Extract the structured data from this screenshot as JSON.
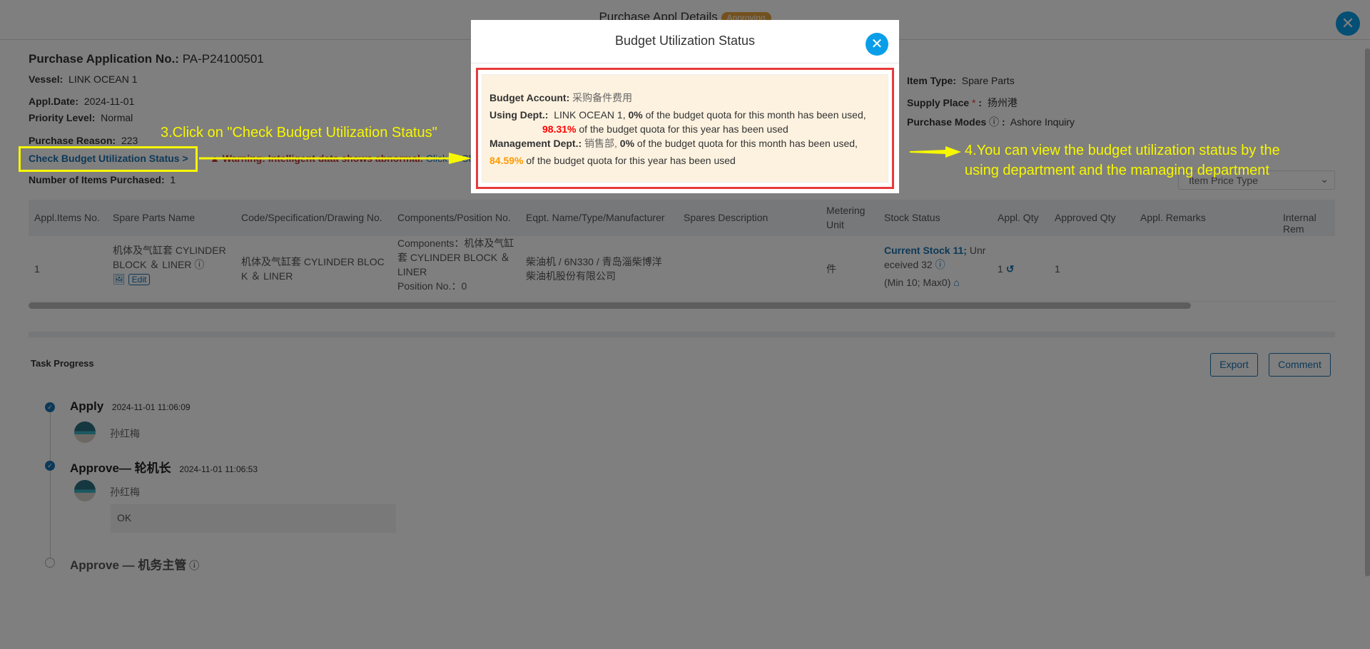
{
  "header": {
    "title": "Purchase Appl Details",
    "status": "Approving"
  },
  "info": {
    "app_no_label": "Purchase Application No.:",
    "app_no": "PA-P24100501",
    "vessel_label": "Vessel:",
    "vessel": "LINK OCEAN 1",
    "date_label": "Appl.Date:",
    "date": "2024-11-01",
    "priority_label": "Priority Level:",
    "priority": "Normal",
    "reason_label": "Purchase Reason:",
    "reason": "223",
    "check_budget_link": "Check Budget Utilization Status >",
    "warning": "Warning: Intelligent data shows abnormal.",
    "warning_link": "Click to Ch",
    "items_label": "Number of Items Purchased:",
    "items": "1",
    "item_type_label": "Item Type:",
    "item_type": "Spare Parts",
    "supply_label": "Supply Place",
    "supply": "扬州港",
    "modes_label": "Purchase Modes",
    "modes": "Ashore Inquiry",
    "price_type_placeholder": "Item Price Type"
  },
  "table": {
    "headers": [
      "Appl.Items No.",
      "Spare Parts Name",
      "Code/Specification/Drawing No.",
      "Components/Position No.",
      "Eqpt. Name/Type/Manufacturer",
      "Spares Description",
      "Metering Unit",
      "Stock Status",
      "Appl. Qty",
      "Approved Qty",
      "Appl. Remarks",
      "Internal Rem"
    ],
    "row": {
      "no": "1",
      "name": "机体及气缸套 CYLINDER BLOCK ＆ LINER",
      "edit": "Edit",
      "code": "机体及气缸套 CYLINDER BLOCK ＆ LINER",
      "components": "Components：机体及气缸套 CYLINDER BLOCK ＆ LINER",
      "position": "Position No.：0",
      "eqpt": "柴油机 / 6N330 / 青岛淄柴博洋柴油机股份有限公司",
      "unit": "件",
      "stock_current": "Current Stock 11;",
      "stock_unreceived": "Unreceived 32",
      "stock_minmax": "(Min 10; Max0)",
      "appl_qty": "1",
      "approved_qty": "1"
    }
  },
  "progress": {
    "title": "Task Progress",
    "export": "Export",
    "comment": "Comment",
    "steps": [
      {
        "name": "Apply",
        "time": "2024-11-01 11:06:09",
        "user": "孙红梅",
        "done": true
      },
      {
        "name": "Approve— 轮机长",
        "time": "2024-11-01 11:06:53",
        "user": "孙红梅",
        "remark": "OK",
        "done": true
      },
      {
        "name": "Approve — 机务主管",
        "done": false
      }
    ]
  },
  "modal": {
    "title": "Budget Utilization Status",
    "account_label": "Budget Account:",
    "account": "采购备件费用",
    "using_label": "Using Dept.:",
    "using_dept": "LINK OCEAN 1,",
    "using_month_pct": "0%",
    "month_text": "of the budget quota for this month has been used,",
    "using_year_pct": "98.31%",
    "year_text": "of the budget quota for this year has been used",
    "mgmt_label": "Management Dept.:",
    "mgmt_dept": "销售部,",
    "mgmt_month_pct": "0%",
    "mgmt_year_pct": "84.59%",
    "colors": {
      "danger": "#ff0000",
      "warning": "#ff9900",
      "panel": "#fdf2e0"
    }
  },
  "annotations": {
    "step3": "3.Click on \"Check Budget Utilization Status\"",
    "step4_line1": "4.You can view the budget utilization status by the",
    "step4_line2": "using department and the managing department"
  }
}
